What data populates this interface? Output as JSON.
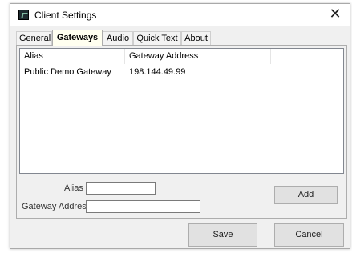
{
  "window": {
    "title": "Client Settings",
    "close_glyph": "✕"
  },
  "tabs": [
    {
      "label": "General",
      "active": false
    },
    {
      "label": "Gateways",
      "active": true
    },
    {
      "label": "Audio",
      "active": false
    },
    {
      "label": "Quick Text",
      "active": false
    },
    {
      "label": "About",
      "active": false
    }
  ],
  "gateways_list": {
    "columns": [
      "Alias",
      "Gateway Address"
    ],
    "rows": [
      {
        "alias": "Public Demo Gateway",
        "address": "198.144.49.99"
      }
    ]
  },
  "form": {
    "alias_label": "Alias",
    "alias_value": "",
    "address_label": "Gateway Address",
    "address_value": "",
    "add_button": "Add"
  },
  "footer": {
    "save_button": "Save",
    "cancel_button": "Cancel"
  },
  "icons": {
    "app": "app-icon",
    "close": "close-icon"
  },
  "colors": {
    "active_tab_bg": "#fffff0",
    "window_bg": "#f0f0f0"
  }
}
